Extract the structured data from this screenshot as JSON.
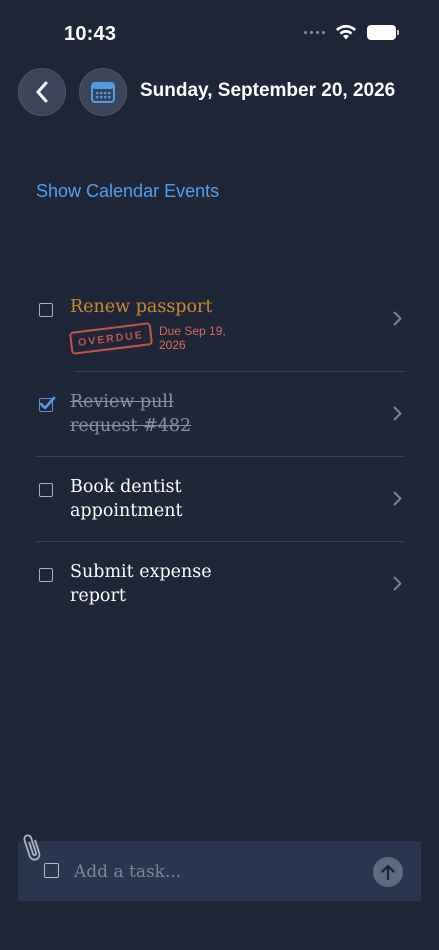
{
  "status_bar": {
    "time": "10:43",
    "icons": [
      "signal-dots-icon",
      "wifi-icon",
      "battery-icon"
    ]
  },
  "header": {
    "back_icon": "chevron-left-icon",
    "calendar_icon": "calendar-icon",
    "date_title": "Sunday, September 20, 2026"
  },
  "show_calendar_events_label": "Show Calendar Events",
  "tasks": [
    {
      "title": "Renew passport",
      "checked": false,
      "badge": "OVERDUE",
      "due": "Due Sep 19, 2026"
    },
    {
      "title": "Review pull request #482",
      "checked": true
    },
    {
      "title": "Book dentist appointment",
      "checked": false
    },
    {
      "title": "Submit expense report",
      "checked": false
    }
  ],
  "composer": {
    "placeholder": "Add a task...",
    "send_icon": "arrow-up-icon",
    "attach_icon": "paperclip-icon"
  },
  "colors": {
    "background": "#1f2638",
    "accent_blue": "#4ea0ee",
    "overdue_title": "#c98a2c",
    "overdue_badge": "#c2544c",
    "completed_text": "#8a909c"
  }
}
